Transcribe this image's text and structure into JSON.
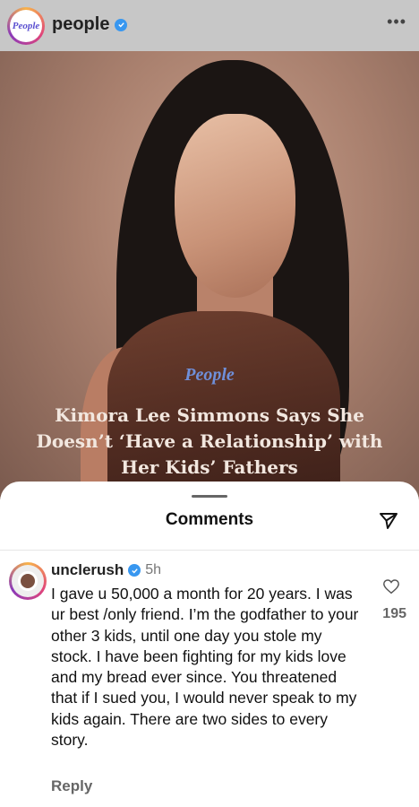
{
  "post": {
    "account_name": "people",
    "avatar_logo_text": "People",
    "more_icon": "ellipsis-icon",
    "verified_icon": "verified-badge-icon"
  },
  "image": {
    "brand_watermark": "People",
    "headline": "Kimora Lee Simmons Says She Doesn’t ‘Have a Relationship’ with Her Kids’ Fathers"
  },
  "comments_sheet": {
    "title": "Comments",
    "share_icon": "send-icon",
    "comment": {
      "username": "unclerush",
      "time": "5h",
      "text": "I gave u 50,000 a month for 20 years. I was ur best /only friend. I’m the godfather to your other 3 kids, until one day you stole my stock. I have been fighting for my kids love and my bread ever since. You threatened that if I sued you, I would never speak to my kids  again. There are two sides to every story.",
      "like_count": "195",
      "reply_label": "Reply"
    }
  },
  "colors": {
    "verified_blue": "#3897f0",
    "topbar_gray": "#c7c7c7"
  }
}
